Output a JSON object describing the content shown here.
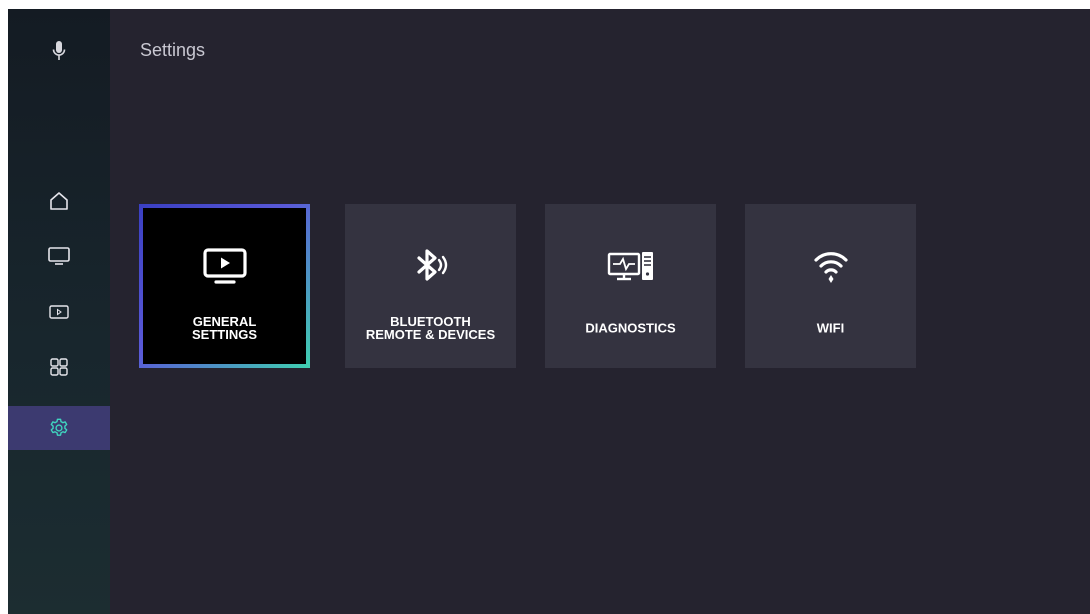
{
  "header": {
    "title": "Settings"
  },
  "sidebar": {
    "items": [
      {
        "name": "voice",
        "icon": "microphone-icon"
      },
      {
        "name": "home",
        "icon": "home-icon"
      },
      {
        "name": "live-tv",
        "icon": "tv-icon"
      },
      {
        "name": "media",
        "icon": "play-box-icon"
      },
      {
        "name": "apps",
        "icon": "apps-grid-icon"
      },
      {
        "name": "settings",
        "icon": "gear-icon",
        "active": true
      }
    ]
  },
  "tiles": [
    {
      "line1": "GENERAL",
      "line2": "SETTINGS",
      "icon": "tv-play-icon",
      "focused": true
    },
    {
      "line1": "BLUETOOTH",
      "line2": "REMOTE & DEVICES",
      "icon": "bluetooth-icon",
      "focused": false
    },
    {
      "line1": "DIAGNOSTICS",
      "line2": "",
      "icon": "computer-diagnostics-icon",
      "focused": false
    },
    {
      "line1": "WIFI",
      "line2": "",
      "icon": "wifi-icon",
      "focused": false
    }
  ],
  "colors": {
    "accent": "#3c3a70",
    "focus_start": "#3a3fc2",
    "focus_end": "#3fd0b0",
    "background": "#25232f",
    "tile": "#343340"
  }
}
